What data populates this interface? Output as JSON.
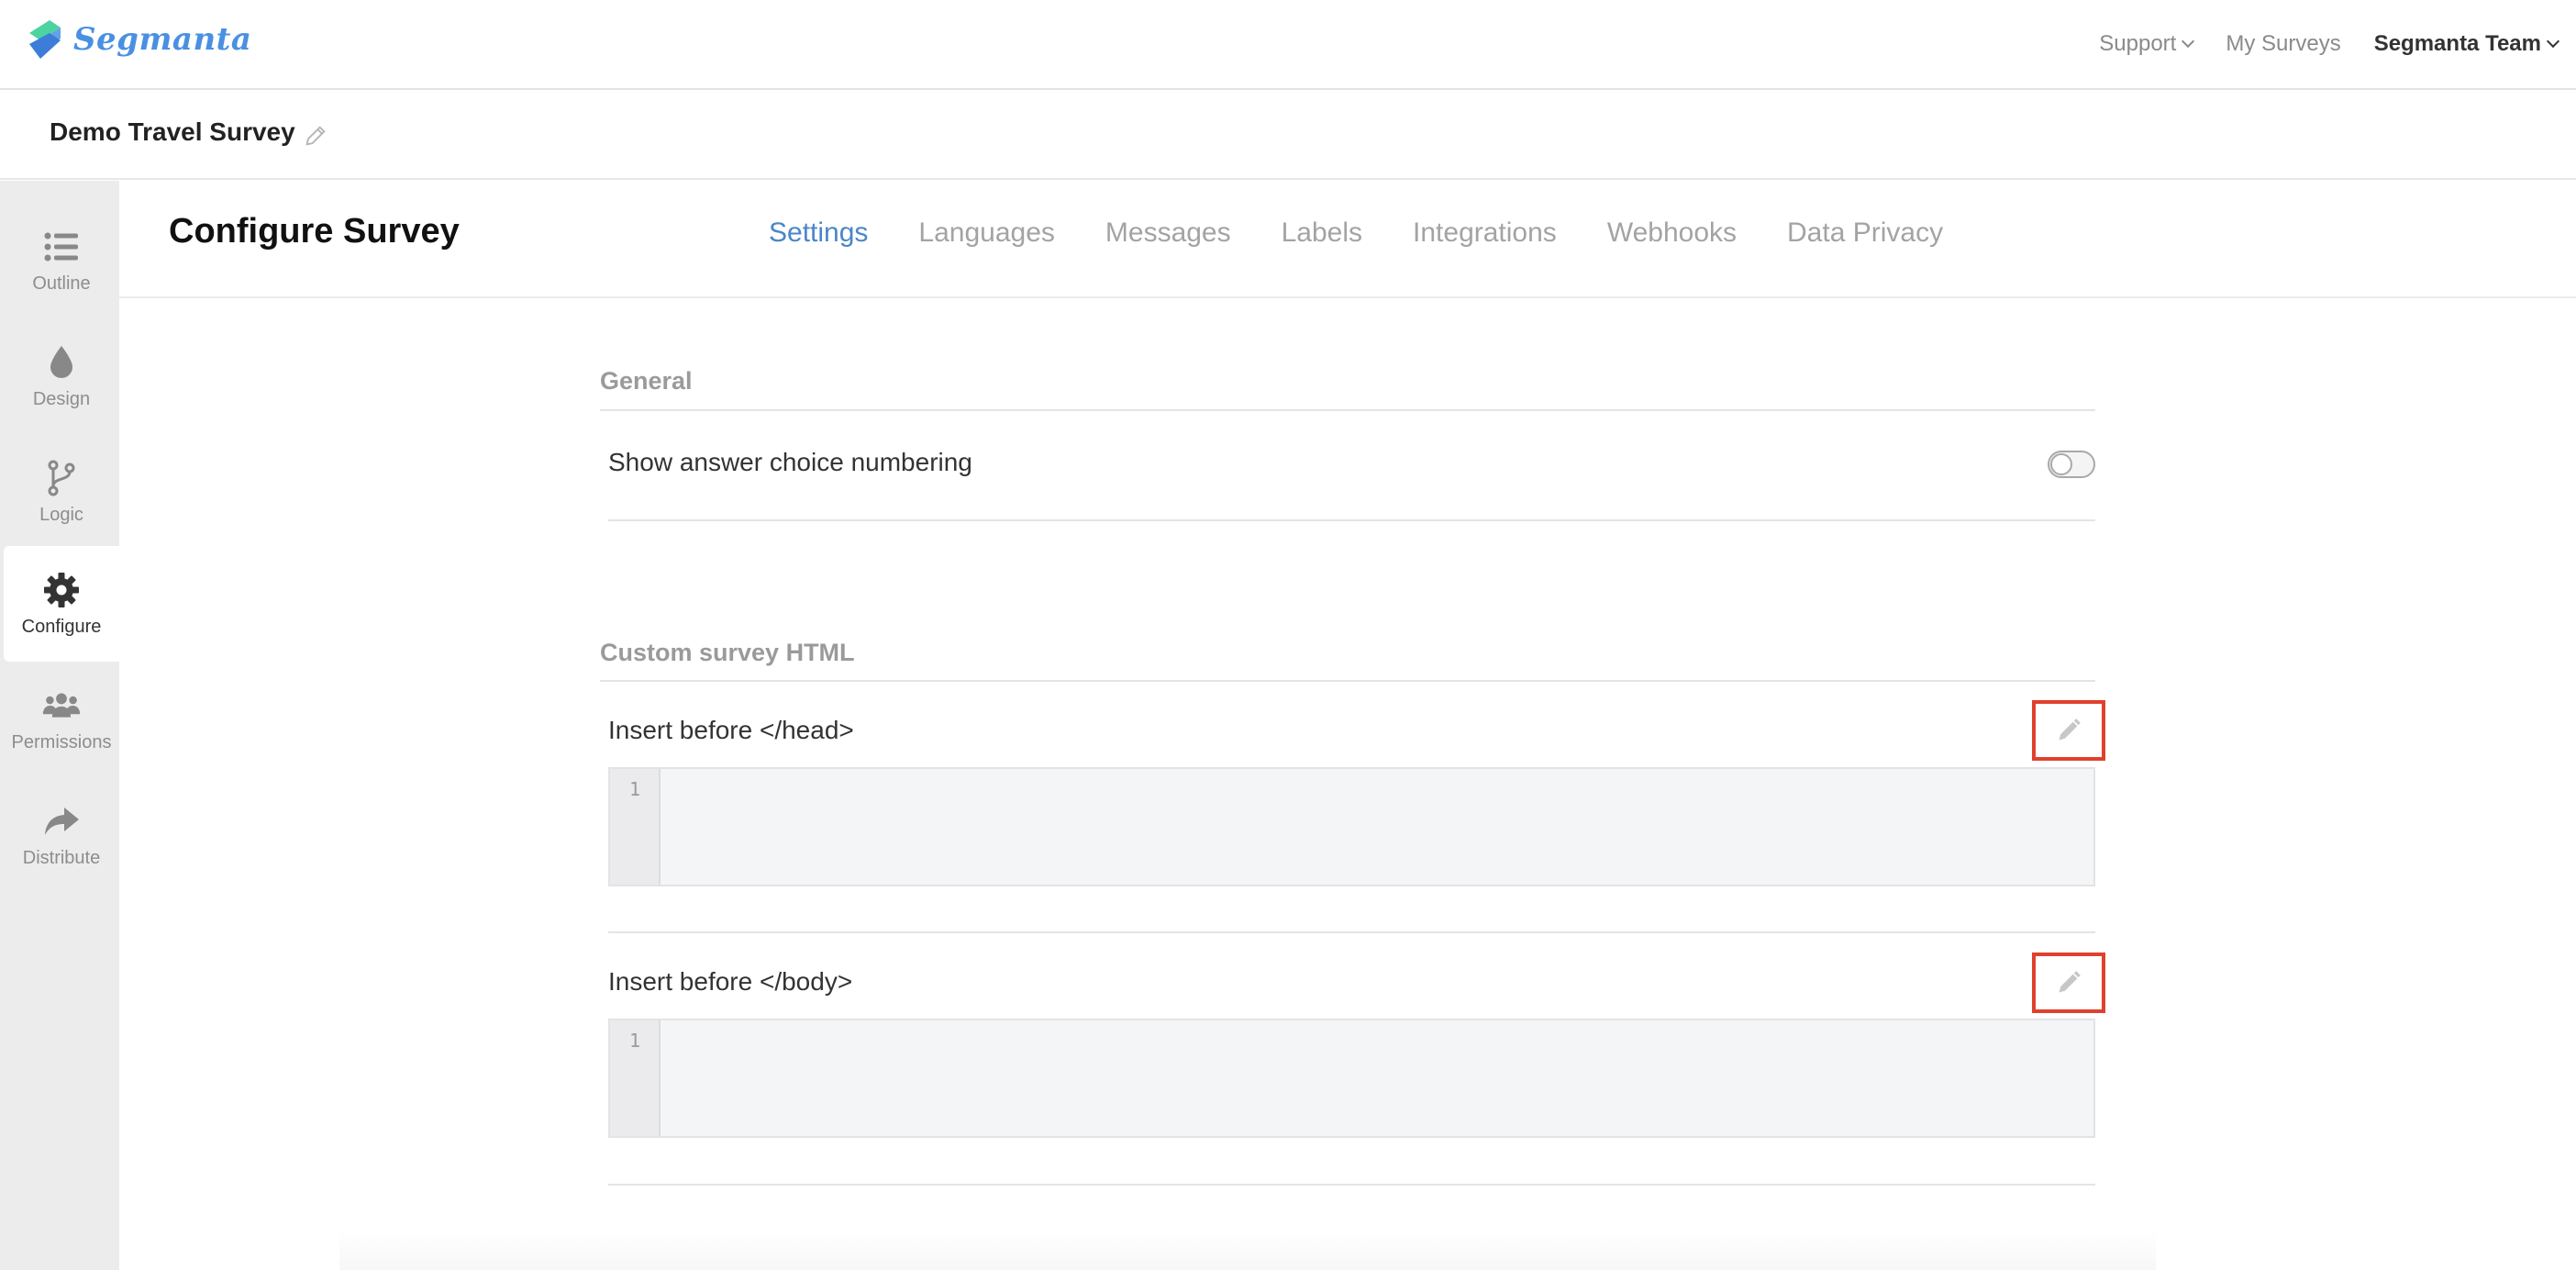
{
  "brand": {
    "name": "Segmanta",
    "color": "#4a90e2"
  },
  "topnav": {
    "support": "Support",
    "my_surveys": "My Surveys",
    "team": "Segmanta Team"
  },
  "survey": {
    "title": "Demo Travel Survey"
  },
  "sidebar": {
    "items": [
      {
        "label": "Outline",
        "icon": "list-icon"
      },
      {
        "label": "Design",
        "icon": "droplet-icon"
      },
      {
        "label": "Logic",
        "icon": "branch-icon"
      },
      {
        "label": "Configure",
        "icon": "gear-icon",
        "active": true
      },
      {
        "label": "Permissions",
        "icon": "users-icon"
      },
      {
        "label": "Distribute",
        "icon": "share-arrow-icon"
      }
    ]
  },
  "page": {
    "title": "Configure Survey",
    "tabs": [
      {
        "label": "Settings",
        "active": true
      },
      {
        "label": "Languages"
      },
      {
        "label": "Messages"
      },
      {
        "label": "Labels"
      },
      {
        "label": "Integrations"
      },
      {
        "label": "Webhooks"
      },
      {
        "label": "Data Privacy"
      }
    ]
  },
  "general": {
    "heading": "General",
    "numbering_label": "Show answer choice numbering",
    "numbering_enabled": false
  },
  "custom_html": {
    "heading": "Custom survey HTML",
    "head_label": "Insert before </head>",
    "body_label": "Insert before </body>",
    "line_number": "1"
  },
  "colors": {
    "accent": "#4a86c8",
    "highlight_border": "#e0402e"
  }
}
